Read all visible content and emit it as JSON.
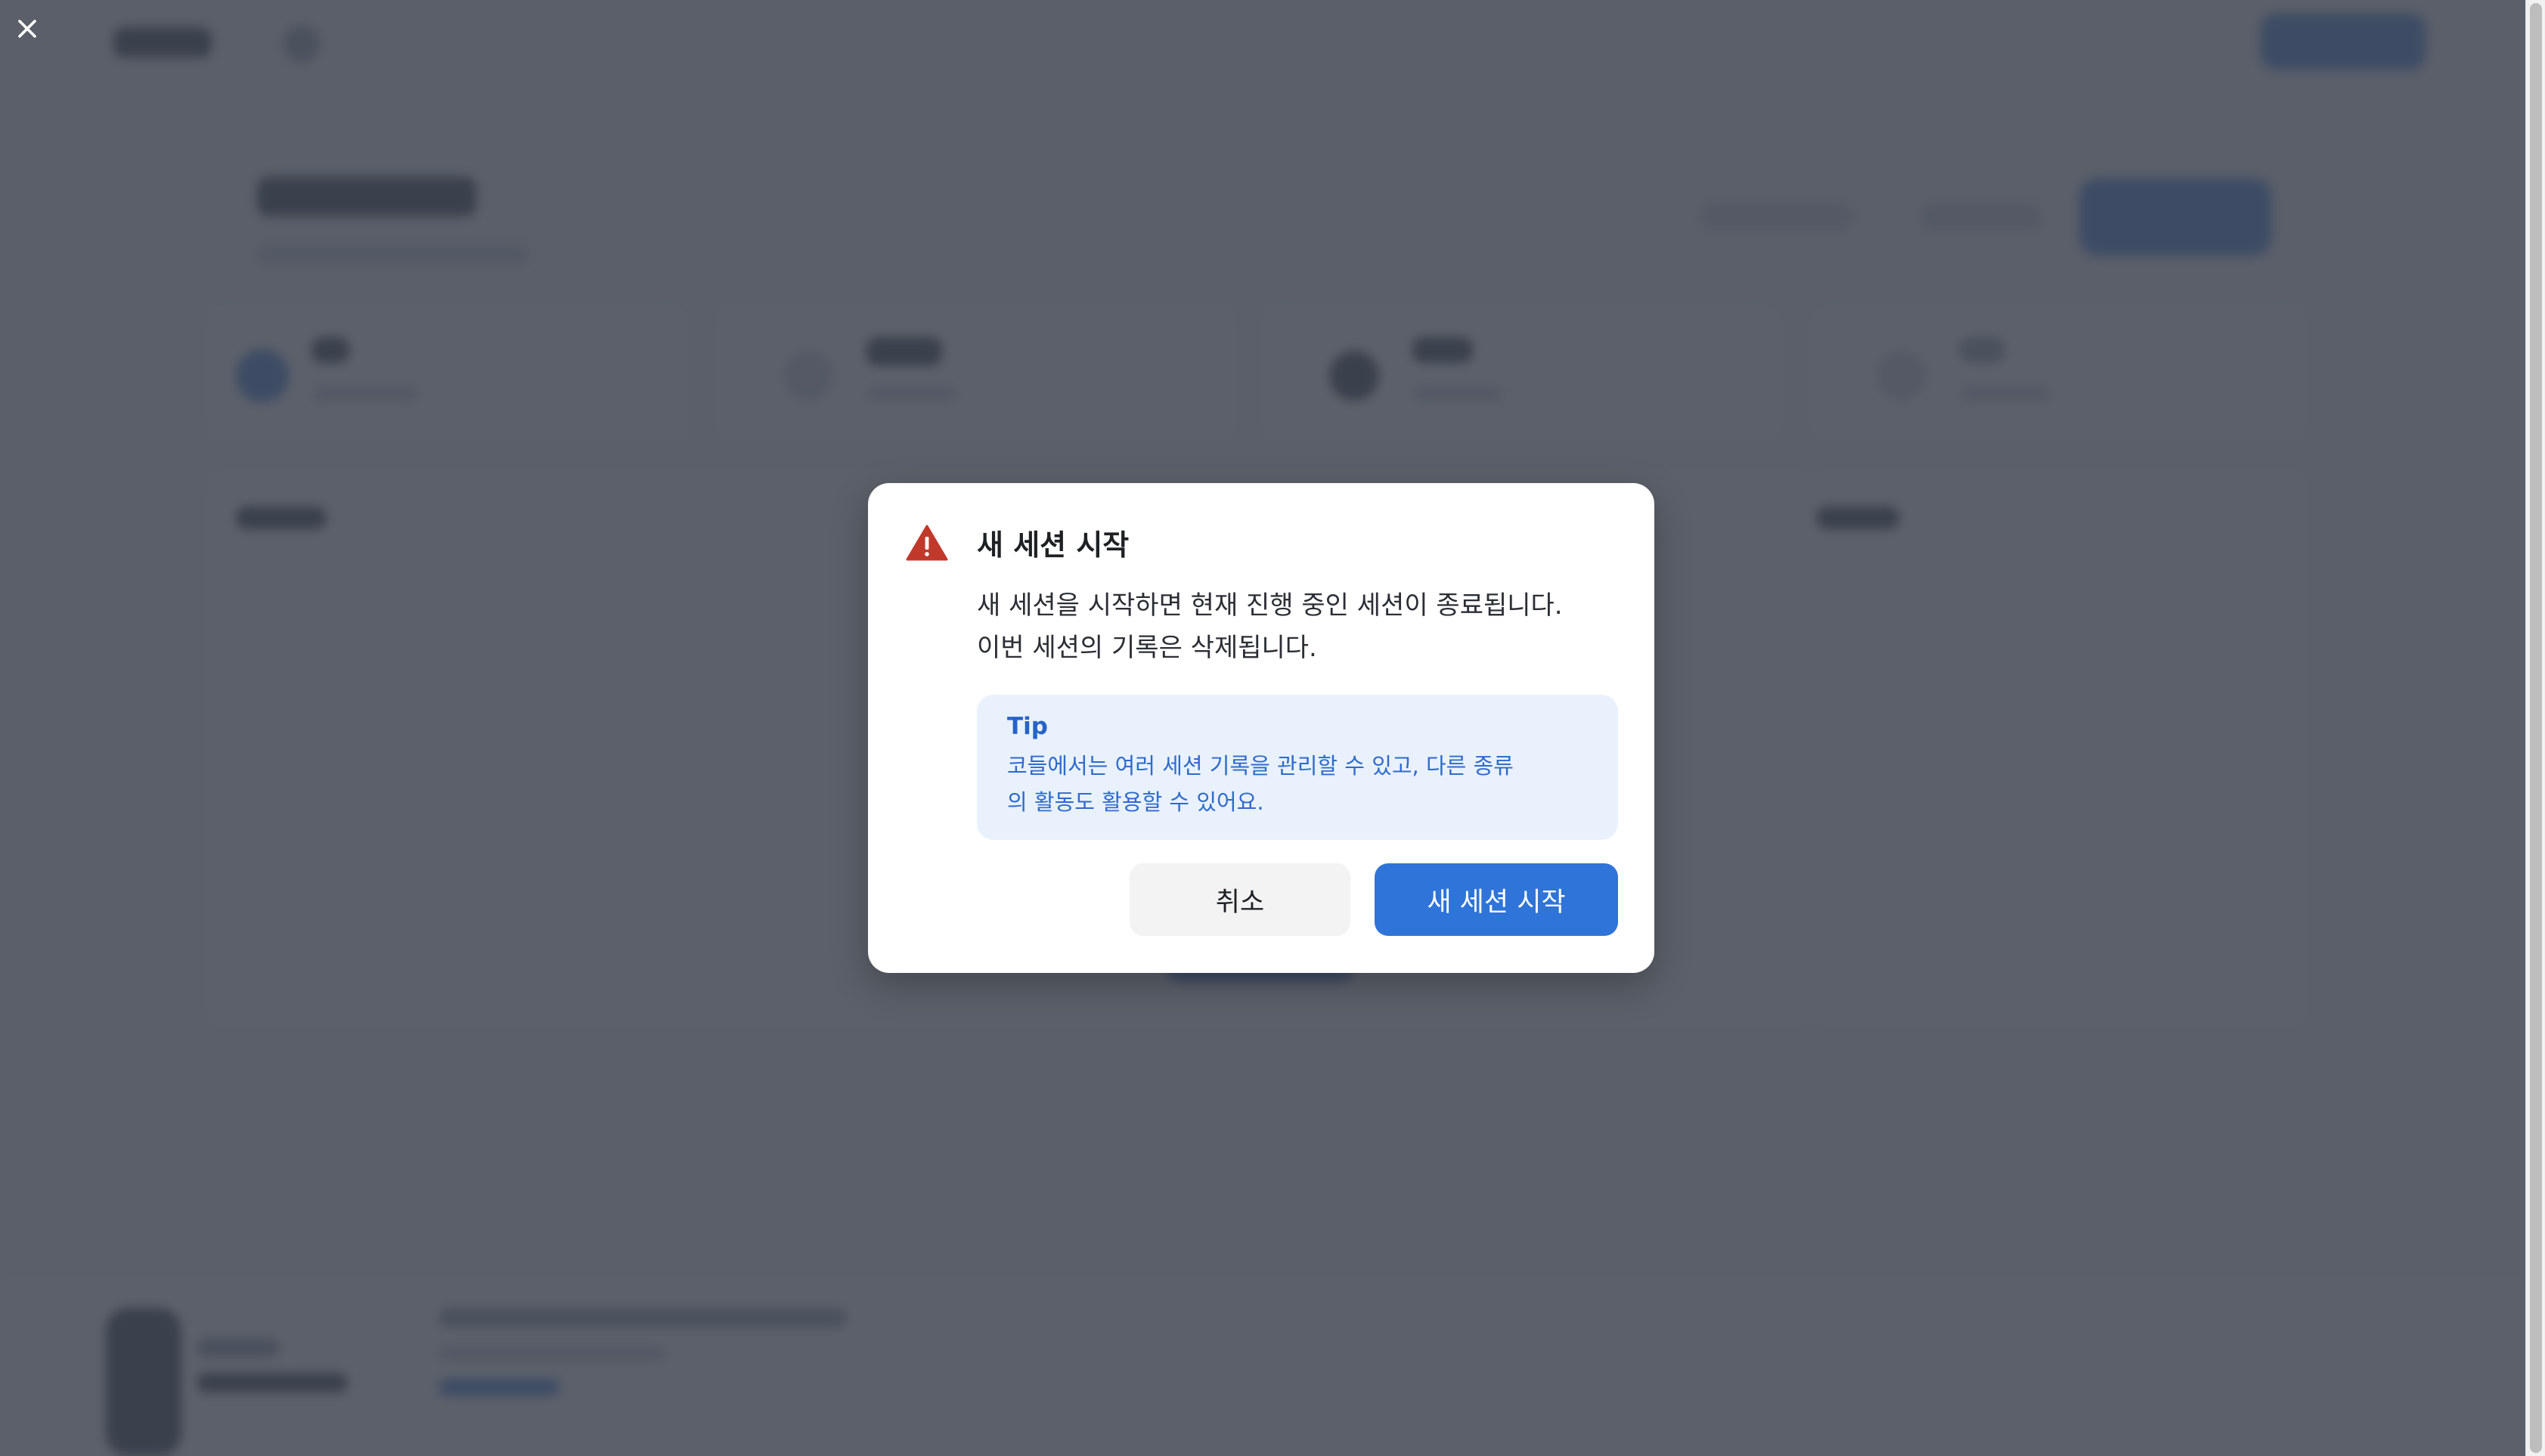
{
  "dialog": {
    "title": "새 세션 시작",
    "body_lines": [
      "새 세션을 시작하면 현재 진행 중인 세션이 종료됩니다.",
      "이번 세션의 기록은 삭제됩니다."
    ],
    "tip": {
      "title": "Tip",
      "lines": [
        "코들에서는 여러 세션 기록을 관리할 수 있고, 다른 종류",
        "의 활동도 활용할 수 있어요."
      ]
    },
    "cancel_label": "취소",
    "confirm_label": "새 세션 시작"
  },
  "colors": {
    "primary": "#2f74d8",
    "warning": "#c0392b",
    "tip_background": "#e9f1fd",
    "tip_text": "#2e6bcc",
    "overlay": "#404652"
  },
  "icons": {
    "close": "close-icon",
    "warning": "warning-triangle-icon"
  }
}
